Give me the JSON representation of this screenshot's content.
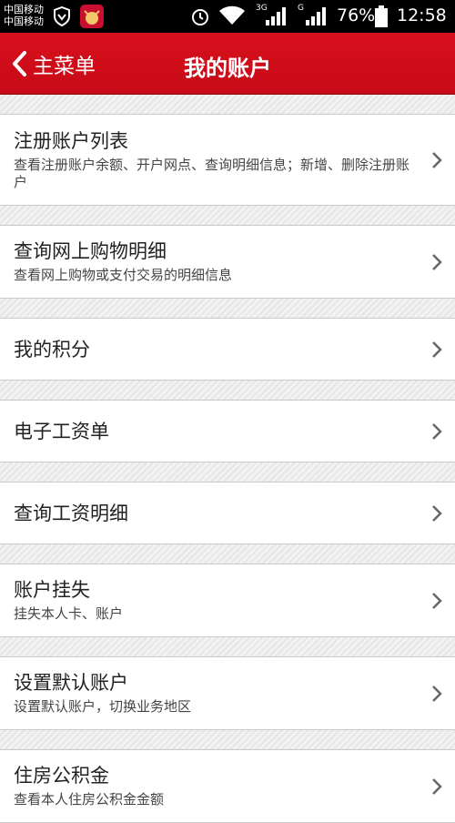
{
  "status_bar": {
    "carrier1": "中国移动",
    "carrier2": "中国移动",
    "net1": "3G",
    "net2": "G",
    "battery": "76%",
    "time": "12:58",
    "icons": [
      "shield-icon",
      "app-icon",
      "alarm-icon",
      "wifi-icon",
      "signal-icon",
      "battery-icon"
    ]
  },
  "header": {
    "back_label": "主菜单",
    "title": "我的账户"
  },
  "menu": [
    {
      "title": "注册账户列表",
      "desc": "查看注册账户余额、开户网点、查询明细信息；新增、删除注册账户"
    },
    {
      "title": "查询网上购物明细",
      "desc": "查看网上购物或支付交易的明细信息"
    },
    {
      "title": "我的积分",
      "desc": ""
    },
    {
      "title": "电子工资单",
      "desc": ""
    },
    {
      "title": "查询工资明细",
      "desc": ""
    },
    {
      "title": "账户挂失",
      "desc": "挂失本人卡、账户"
    },
    {
      "title": "设置默认账户",
      "desc": "设置默认账户，切换业务地区"
    },
    {
      "title": "住房公积金",
      "desc": "查看本人住房公积金金额"
    }
  ],
  "colors": {
    "header_red": "#d80f1c",
    "status_black": "#000000"
  }
}
